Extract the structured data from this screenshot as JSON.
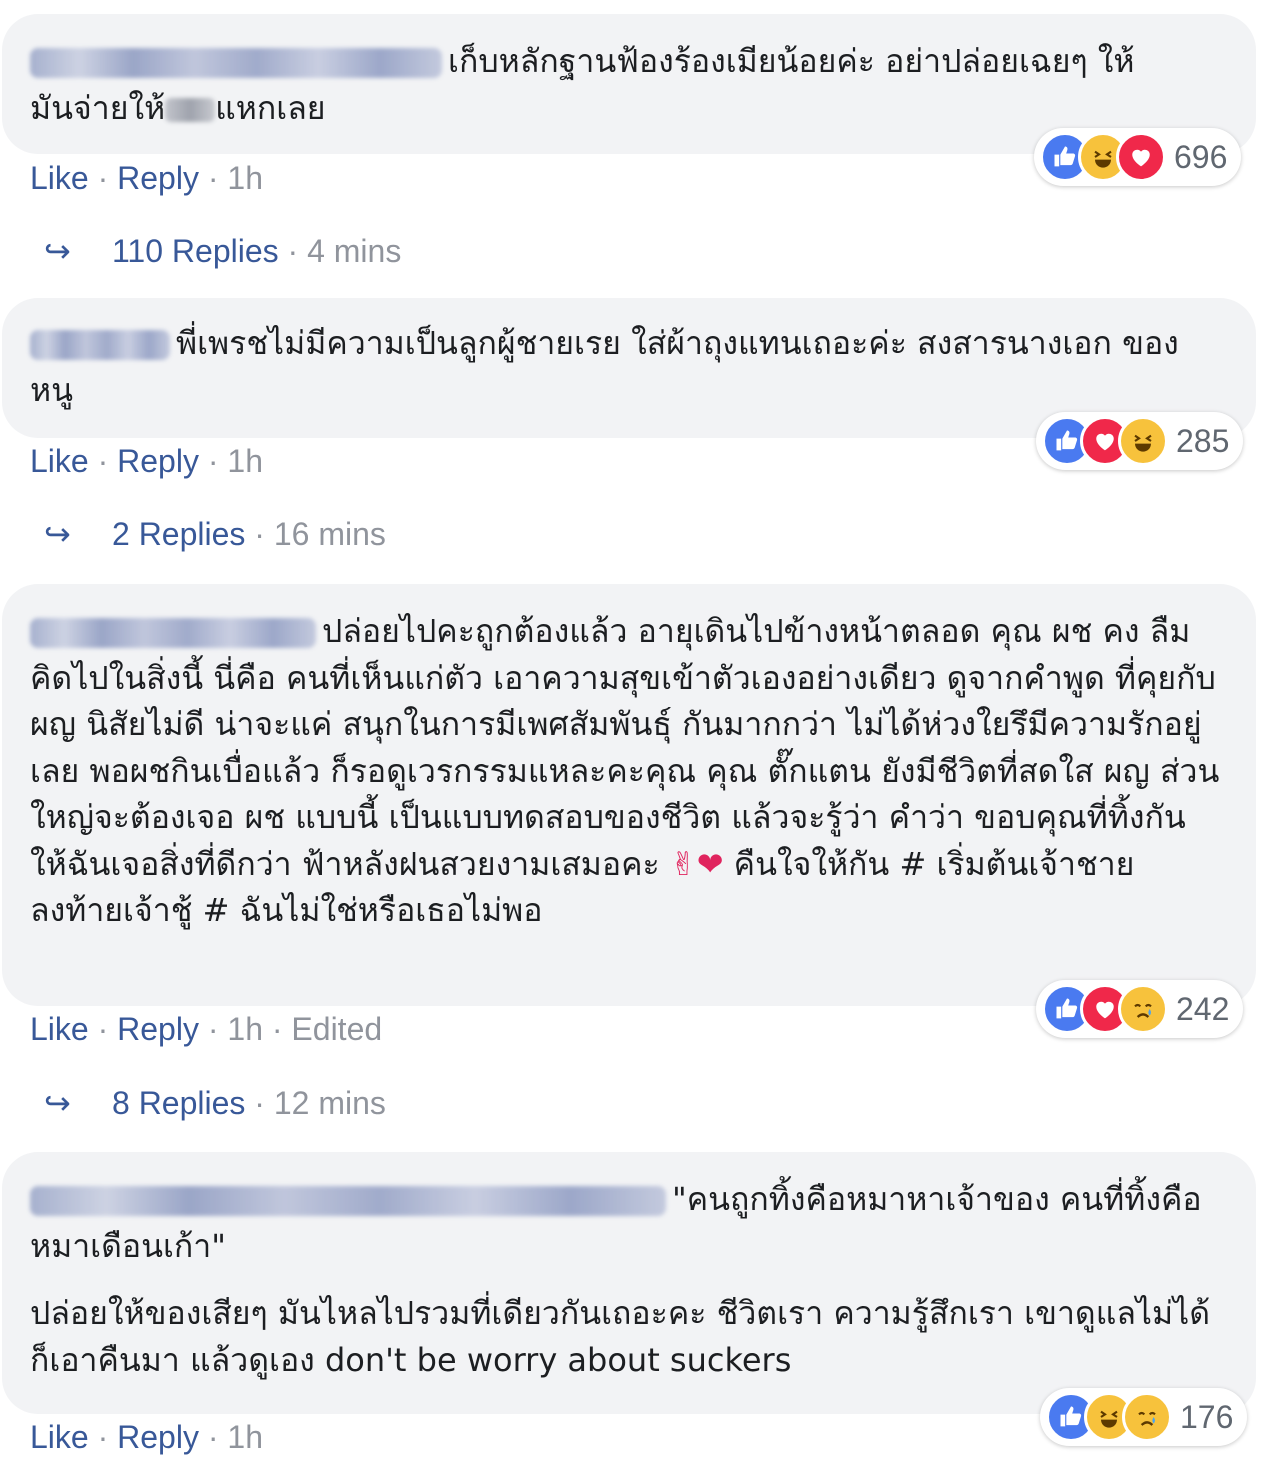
{
  "comments": [
    {
      "text_lines": [
        "เก็บหลักฐานฟ้องร้องเมียน้อยค่ะ อย่าปล่อยเฉยๆ ให้",
        "มันจ่ายให้"
      ],
      "text_tail": "แหกเลย",
      "actions": {
        "like": "Like",
        "reply": "Reply",
        "time": "1h"
      },
      "reactions": {
        "icons": [
          "like-icon",
          "haha-icon",
          "love-icon"
        ],
        "count": "696"
      },
      "replies": {
        "count": "110 Replies",
        "time": "4 mins"
      }
    },
    {
      "text": "พี่เพรชไม่มีความเป็นลูกผู้ชายเรย ใส่ผ้าถุงแทนเถอะค่ะ สงสารนางเอก ของหนู",
      "actions": {
        "like": "Like",
        "reply": "Reply",
        "time": "1h"
      },
      "reactions": {
        "icons": [
          "like-icon",
          "love-icon",
          "haha-icon"
        ],
        "count": "285"
      },
      "replies": {
        "count": "2 Replies",
        "time": "16 mins"
      }
    },
    {
      "text": "ปล่อยไปคะถูกต้องแล้ว อายุเดินไปข้างหน้าตลอด คุณ ผช คง ลืมคิดไปในสิ่งนี้ นี่คือ คนที่เห็นแก่ตัว เอาความสุขเข้าตัวเองอย่างเดียว ดูจากคำพูด ที่คุยกับ ผญ นิสัยไม่ดี น่าจะแค่ สนุกในการมีเพศสัมพันธุ์ กันมากกว่า ไม่ได้ห่วงใยรึมีความรักอยู่เลย พอผชกินเบื่อแล้ว ก็รอดูเวรกรรมแหละคะคุณ คุณ ตั๊กแตน ยังมีชีวิตที่สดใส ผญ ส่วนใหญ่จะต้องเจอ ผช แบบนี้ เป็นแบบทดสอบของชีวิต แล้วจะรู้ว่า คำว่า ขอบคุณที่ทิ้งกัน ให้ฉันเจอสิ่งที่ดีกว่า ฟ้าหลังฝนสวยงามเสมอคะ",
      "emoji": "✌❤",
      "text_after": "คืนใจให้กัน # เริ่มต้นเจ้าชายลงท้ายเจ้าชู้ # ฉันไม่ใช่หรือเธอไม่พอ",
      "actions": {
        "like": "Like",
        "reply": "Reply",
        "time": "1h",
        "edited": "Edited"
      },
      "reactions": {
        "icons": [
          "like-icon",
          "love-icon",
          "sad-icon"
        ],
        "count": "242"
      },
      "replies": {
        "count": "8 Replies",
        "time": "12 mins"
      }
    },
    {
      "text": "\"คนถูกทิ้งคือหมาหาเจ้าของ คนที่ทิ้งคือหมาเดือนเก้า\"",
      "text2": "ปล่อยให้ของเสียๆ มันไหลไปรวมที่เดียวกันเถอะคะ ชีวิตเรา ความรู้สึกเรา เขาดูแลไม่ได้ก็เอาคืนมา แล้วดูเอง don't be worry about suckers",
      "actions": {
        "like": "Like",
        "reply": "Reply",
        "time": "1h"
      },
      "reactions": {
        "icons": [
          "like-icon",
          "haha-icon",
          "sad-icon"
        ],
        "count": "176"
      }
    }
  ],
  "colors": {
    "link": "#385898",
    "bubble": "#f2f3f5",
    "muted": "#90949c",
    "like": "#4a7af0",
    "love": "#f0284a",
    "haha": "#f7c23c"
  },
  "symbols": {
    "dot": "·",
    "reply_arrow": "↪"
  }
}
